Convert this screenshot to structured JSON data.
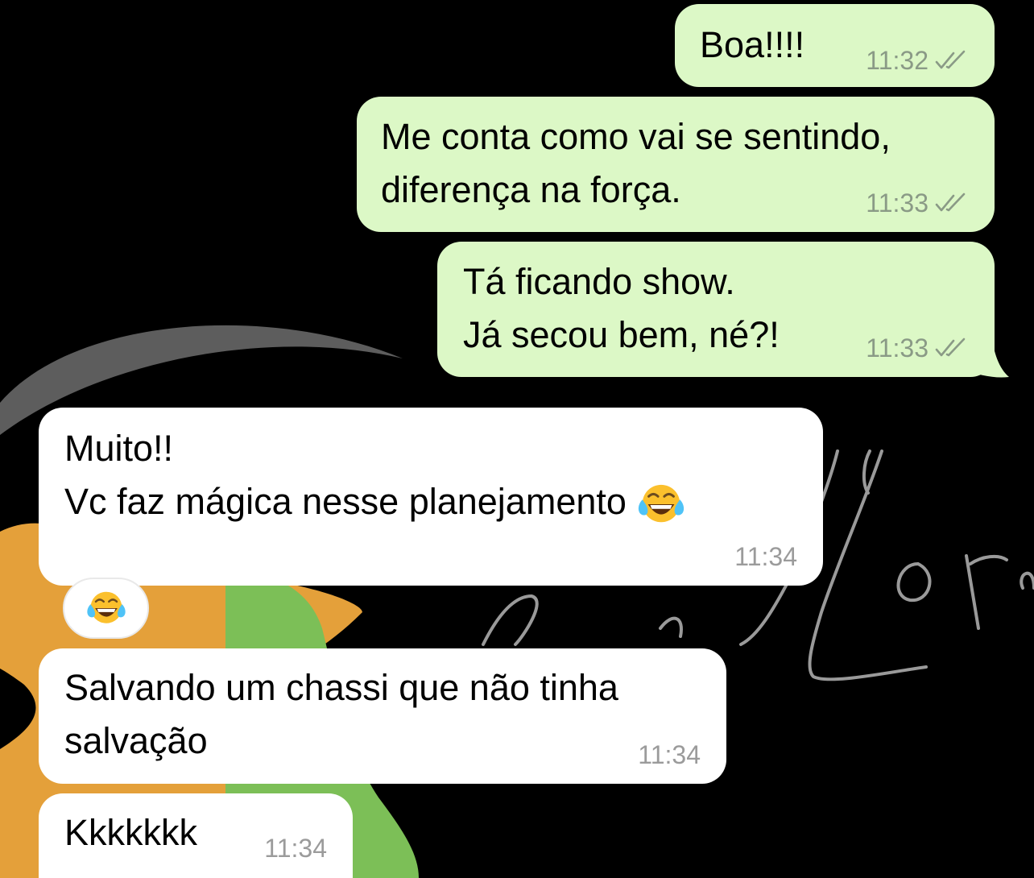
{
  "colors": {
    "outgoing_bubble": "#dcf8c6",
    "incoming_bubble": "#ffffff",
    "background": "#000000",
    "meta_text": "#8a9a86",
    "read_ticks": "#8a9a86"
  },
  "messages": [
    {
      "direction": "outgoing",
      "lines": [
        "Boa!!!!"
      ],
      "time": "11:32",
      "status_icon": "double-check-icon"
    },
    {
      "direction": "outgoing",
      "lines": [
        "Me conta como vai se sentindo,",
        "diferença na força."
      ],
      "time": "11:33",
      "status_icon": "double-check-icon"
    },
    {
      "direction": "outgoing",
      "lines": [
        "Tá ficando show.",
        "Já secou bem, né?!"
      ],
      "time": "11:33",
      "status_icon": "double-check-icon"
    },
    {
      "direction": "incoming",
      "lines": [
        "Muito!!",
        "Vc faz mágica nesse planejamento"
      ],
      "emoji": "tears-of-joy-emoji",
      "time": "11:34"
    },
    {
      "direction": "incoming",
      "lines": [
        "Salvando um chassi que não tinha",
        "salvação"
      ],
      "time": "11:34"
    },
    {
      "direction": "incoming",
      "lines": [
        "Kkkkkkk"
      ],
      "time": "11:34"
    }
  ],
  "reaction": {
    "emoji": "tears-of-joy-emoji"
  }
}
